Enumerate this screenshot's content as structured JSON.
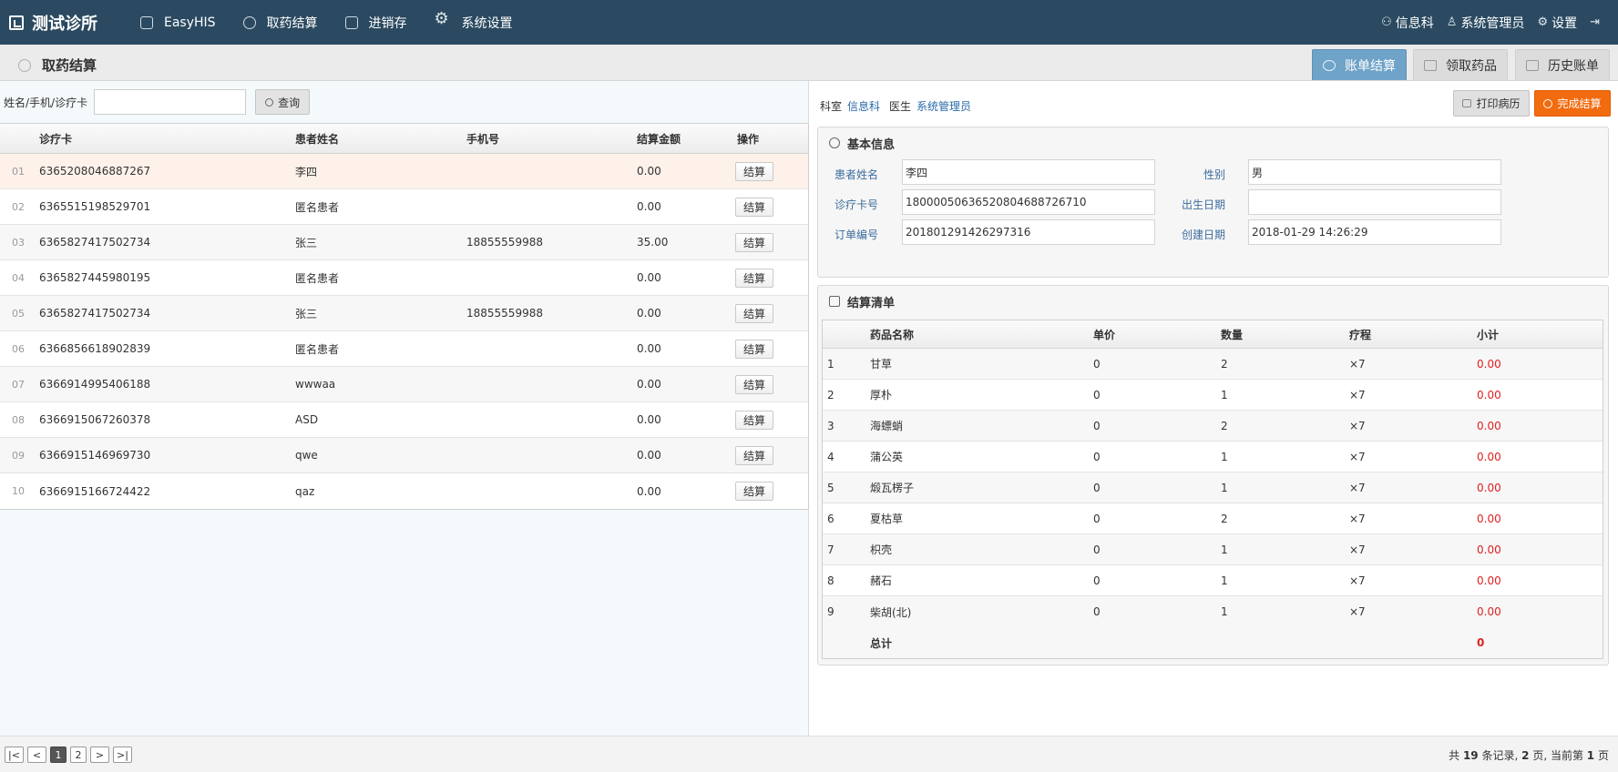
{
  "nav": {
    "brand": "测试诊所",
    "items": [
      {
        "label": "EasyHIS",
        "icon": "pulse-icon"
      },
      {
        "label": "取药结算",
        "icon": "settle-icon"
      },
      {
        "label": "进销存",
        "icon": "inventory-icon"
      },
      {
        "label": "系统设置",
        "icon": "gear-icon"
      }
    ],
    "right": {
      "dept": "信息科",
      "user": "系统管理员",
      "settings": "设置"
    }
  },
  "subheader": {
    "title": "取药结算",
    "tabs": [
      {
        "label": "账单结算",
        "active": true
      },
      {
        "label": "领取药品",
        "active": false
      },
      {
        "label": "历史账单",
        "active": false
      }
    ]
  },
  "search": {
    "label": "姓名/手机/诊疗卡",
    "value": "",
    "button": "查询"
  },
  "patients": {
    "headers": {
      "card": "诊疗卡",
      "name": "患者姓名",
      "phone": "手机号",
      "amount": "结算金额",
      "op": "操作"
    },
    "op_label": "结算",
    "rows": [
      {
        "idx": "01",
        "card": "6365208046887267",
        "name": "李四",
        "phone": "",
        "amount": "0.00"
      },
      {
        "idx": "02",
        "card": "6365515198529701",
        "name": "匿名患者",
        "phone": "",
        "amount": "0.00"
      },
      {
        "idx": "03",
        "card": "6365827417502734",
        "name": "张三",
        "phone": "18855559988",
        "amount": "35.00"
      },
      {
        "idx": "04",
        "card": "6365827445980195",
        "name": "匿名患者",
        "phone": "",
        "amount": "0.00"
      },
      {
        "idx": "05",
        "card": "6365827417502734",
        "name": "张三",
        "phone": "18855559988",
        "amount": "0.00"
      },
      {
        "idx": "06",
        "card": "6366856618902839",
        "name": "匿名患者",
        "phone": "",
        "amount": "0.00"
      },
      {
        "idx": "07",
        "card": "6366914995406188",
        "name": "wwwaa",
        "phone": "",
        "amount": "0.00"
      },
      {
        "idx": "08",
        "card": "6366915067260378",
        "name": "ASD",
        "phone": "",
        "amount": "0.00"
      },
      {
        "idx": "09",
        "card": "6366915146969730",
        "name": "qwe",
        "phone": "",
        "amount": "0.00"
      },
      {
        "idx": "10",
        "card": "6366915166724422",
        "name": "qaz",
        "phone": "",
        "amount": "0.00"
      }
    ]
  },
  "right": {
    "dept_label": "科室",
    "dept_value": "信息科",
    "doctor_label": "医生",
    "doctor_value": "系统管理员",
    "print_button": "打印病历",
    "done_button": "完成结算",
    "basic": {
      "title": "基本信息",
      "patient_name_label": "患者姓名",
      "patient_name": "李四",
      "gender_label": "性别",
      "gender": "男",
      "card_label": "诊疗卡号",
      "card": "18000050636520804688726710",
      "birth_label": "出生日期",
      "birth": "",
      "order_label": "订单编号",
      "order": "201801291426297316",
      "created_label": "创建日期",
      "created": "2018-01-29 14:26:29"
    },
    "bill": {
      "title": "结算清单",
      "headers": {
        "name": "药品名称",
        "price": "单价",
        "qty": "数量",
        "course": "疗程",
        "subtotal": "小计"
      },
      "rows": [
        {
          "idx": "1",
          "name": "甘草",
          "price": "0",
          "qty": "2",
          "course": "×7",
          "subtotal": "0.00"
        },
        {
          "idx": "2",
          "name": "厚朴",
          "price": "0",
          "qty": "1",
          "course": "×7",
          "subtotal": "0.00"
        },
        {
          "idx": "3",
          "name": "海螵蛸",
          "price": "0",
          "qty": "2",
          "course": "×7",
          "subtotal": "0.00"
        },
        {
          "idx": "4",
          "name": "蒲公英",
          "price": "0",
          "qty": "1",
          "course": "×7",
          "subtotal": "0.00"
        },
        {
          "idx": "5",
          "name": "煅瓦楞子",
          "price": "0",
          "qty": "1",
          "course": "×7",
          "subtotal": "0.00"
        },
        {
          "idx": "6",
          "name": "夏枯草",
          "price": "0",
          "qty": "2",
          "course": "×7",
          "subtotal": "0.00"
        },
        {
          "idx": "7",
          "name": "枳壳",
          "price": "0",
          "qty": "1",
          "course": "×7",
          "subtotal": "0.00"
        },
        {
          "idx": "8",
          "name": "赭石",
          "price": "0",
          "qty": "1",
          "course": "×7",
          "subtotal": "0.00"
        },
        {
          "idx": "9",
          "name": "柴胡(北)",
          "price": "0",
          "qty": "1",
          "course": "×7",
          "subtotal": "0.00"
        }
      ],
      "total_label": "总计",
      "total": "0"
    }
  },
  "pager": {
    "first": "|<",
    "prev": "<",
    "pages": [
      "1",
      "2"
    ],
    "current": "1",
    "next": ">",
    "last": ">|",
    "info_prefix": "共",
    "total_records": "19",
    "info_mid1": "条记录,",
    "total_pages": "2",
    "info_mid2": "页, 当前第",
    "current_page": "1",
    "info_suffix": "页"
  },
  "colors": {
    "nav_bg": "#2b4a61",
    "active_tab": "#6fa3c8",
    "done_button": "#f26b0f",
    "subtotal_red": "#dd2222",
    "label_blue": "#3c6d9c"
  }
}
